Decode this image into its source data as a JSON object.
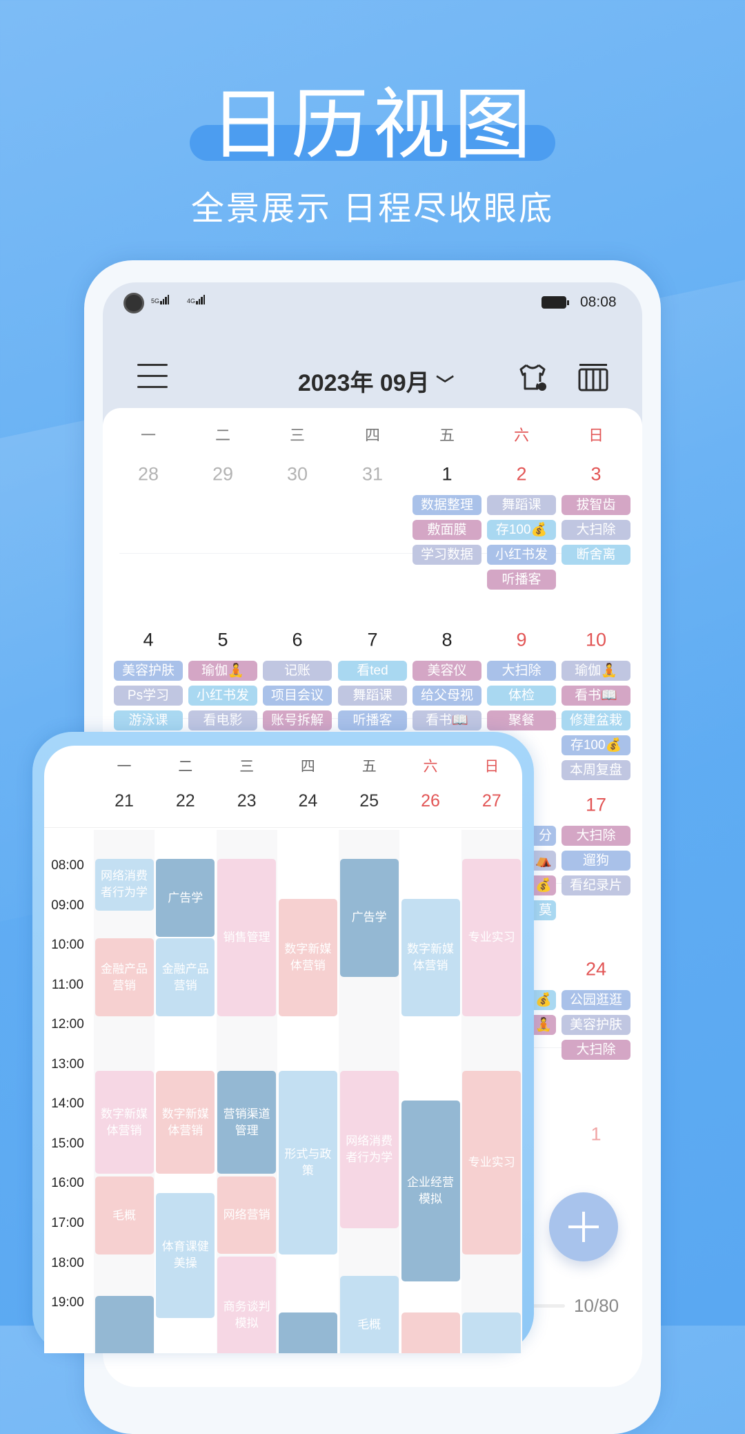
{
  "promo": {
    "title": "日历视图",
    "subtitle": "全景展示  日程尽收眼底"
  },
  "status_bar": {
    "network1": "5G",
    "network2": "4G",
    "time": "08:08"
  },
  "header": {
    "title": "2023年 09月",
    "dropdown_icon": "chevron-down-icon",
    "icons": [
      "menu-icon",
      "theme-shirt-icon",
      "view-switch-icon"
    ]
  },
  "colors": {
    "blue": "#a9c1e9",
    "lavender": "#c0c6e1",
    "mauve": "#d4a6c5",
    "cyan": "#a9d8f1",
    "weekend": "#e25555",
    "ev_light": "#c3dff2",
    "ev_dark": "#94b8d3",
    "ev_pink": "#f6d7e4",
    "ev_salmon": "#f6d0d0"
  },
  "month": {
    "weekdays": [
      "一",
      "二",
      "三",
      "四",
      "五",
      "六",
      "日"
    ],
    "weeks": [
      {
        "days": [
          {
            "weekday": 1,
            "date": "28",
            "other": true,
            "events": []
          },
          {
            "weekday": 2,
            "date": "29",
            "other": true,
            "events": []
          },
          {
            "weekday": 3,
            "date": "30",
            "other": true,
            "events": []
          },
          {
            "weekday": 4,
            "date": "31",
            "other": true,
            "events": []
          },
          {
            "weekday": 5,
            "date": "1",
            "events": [
              {
                "label": "数据整理",
                "color": "blue"
              },
              {
                "label": "敷面膜",
                "color": "mauve"
              },
              {
                "label": "学习数据",
                "color": "lavender"
              }
            ]
          },
          {
            "weekday": 6,
            "date": "2",
            "events": [
              {
                "label": "舞蹈课",
                "color": "lavender"
              },
              {
                "label": "存100💰",
                "color": "cyan"
              },
              {
                "label": "小红书发",
                "color": "blue"
              },
              {
                "label": "听播客",
                "color": "mauve"
              }
            ]
          },
          {
            "weekday": 7,
            "date": "3",
            "events": [
              {
                "label": "拔智齿",
                "color": "mauve"
              },
              {
                "label": "大扫除",
                "color": "lavender"
              },
              {
                "label": "断舍离",
                "color": "cyan"
              }
            ]
          }
        ]
      },
      {
        "days": [
          {
            "weekday": 1,
            "date": "4",
            "events": [
              {
                "label": "美容护肤",
                "color": "blue"
              },
              {
                "label": "Ps学习",
                "color": "lavender"
              },
              {
                "label": "游泳课",
                "color": "cyan"
              }
            ]
          },
          {
            "weekday": 2,
            "date": "5",
            "events": [
              {
                "label": "瑜伽🧘",
                "color": "mauve"
              },
              {
                "label": "小红书发",
                "color": "cyan"
              },
              {
                "label": "看电影",
                "color": "lavender"
              }
            ]
          },
          {
            "weekday": 3,
            "date": "6",
            "events": [
              {
                "label": "记账",
                "color": "lavender"
              },
              {
                "label": "项目会议",
                "color": "blue"
              },
              {
                "label": "账号拆解",
                "color": "mauve"
              }
            ]
          },
          {
            "weekday": 4,
            "date": "7",
            "events": [
              {
                "label": "看ted",
                "color": "cyan"
              },
              {
                "label": "舞蹈课",
                "color": "lavender"
              },
              {
                "label": "听播客",
                "color": "blue"
              }
            ]
          },
          {
            "weekday": 5,
            "date": "8",
            "events": [
              {
                "label": "美容仪",
                "color": "mauve"
              },
              {
                "label": "给父母视",
                "color": "blue"
              },
              {
                "label": "看书📖",
                "color": "lavender"
              }
            ]
          },
          {
            "weekday": 6,
            "date": "9",
            "events": [
              {
                "label": "大扫除",
                "color": "blue"
              },
              {
                "label": "体检",
                "color": "cyan"
              },
              {
                "label": "聚餐",
                "color": "mauve"
              }
            ]
          },
          {
            "weekday": 7,
            "date": "10",
            "events": [
              {
                "label": "瑜伽🧘",
                "color": "lavender"
              },
              {
                "label": "看书📖",
                "color": "mauve"
              },
              {
                "label": "修建盆栽",
                "color": "cyan"
              },
              {
                "label": "存100💰",
                "color": "blue"
              },
              {
                "label": "本周复盘",
                "color": "lavender"
              }
            ]
          }
        ]
      },
      {
        "days": [
          {
            "weekday": 6,
            "date": "",
            "fragment": true,
            "events": [
              {
                "label": "分",
                "color": "blue"
              },
              {
                "label": "⛺",
                "color": "lavender"
              },
              {
                "label": "💰",
                "color": "mauve"
              },
              {
                "label": "莫",
                "color": "cyan"
              }
            ]
          },
          {
            "weekday": 7,
            "date": "17",
            "events": [
              {
                "label": "大扫除",
                "color": "mauve"
              },
              {
                "label": "遛狗",
                "color": "blue"
              },
              {
                "label": "看纪录片",
                "color": "lavender"
              }
            ]
          }
        ]
      },
      {
        "days": [
          {
            "weekday": 6,
            "date": "",
            "fragment": true,
            "events": [
              {
                "label": "💰",
                "color": "cyan"
              },
              {
                "label": "🧘",
                "color": "mauve"
              }
            ]
          },
          {
            "weekday": 7,
            "date": "24",
            "events": [
              {
                "label": "公园逛逛",
                "color": "blue"
              },
              {
                "label": "美容护肤",
                "color": "lavender"
              },
              {
                "label": "大扫除",
                "color": "mauve"
              }
            ]
          }
        ]
      },
      {
        "days": [
          {
            "weekday": 7,
            "date": "1",
            "other": true,
            "faint": true,
            "events": []
          }
        ]
      }
    ]
  },
  "footer": {
    "counter": "10/80",
    "progress": 0.125,
    "add_button_icon": "plus-icon"
  },
  "week": {
    "weekdays": [
      "一",
      "二",
      "三",
      "四",
      "五",
      "六",
      "日"
    ],
    "dates": [
      "21",
      "22",
      "23",
      "24",
      "25",
      "26",
      "27"
    ],
    "hours": [
      "08:00",
      "09:00",
      "10:00",
      "11:00",
      "12:00",
      "13:00",
      "14:00",
      "15:00",
      "16:00",
      "17:00",
      "18:00",
      "19:00"
    ],
    "events": [
      {
        "day": 1,
        "start": "08:00",
        "end": "09:20",
        "title": "网络消费者行为学",
        "color": "ev_light"
      },
      {
        "day": 1,
        "start": "10:00",
        "end": "12:00",
        "title": "金融产品营销",
        "color": "ev_salmon"
      },
      {
        "day": 1,
        "start": "13:20",
        "end": "15:58",
        "title": "数字新媒体营销",
        "color": "ev_pink"
      },
      {
        "day": 1,
        "start": "16:00",
        "end": "18:00",
        "title": "毛概",
        "color": "ev_salmon"
      },
      {
        "day": 1,
        "start": "19:00",
        "end": "21:00",
        "title": "",
        "color": "ev_dark"
      },
      {
        "day": 2,
        "start": "08:00",
        "end": "10:00",
        "title": "广告学",
        "color": "ev_dark"
      },
      {
        "day": 2,
        "start": "10:00",
        "end": "12:00",
        "title": "金融产品营销",
        "color": "ev_light"
      },
      {
        "day": 2,
        "start": "13:20",
        "end": "15:58",
        "title": "数字新媒体营销",
        "color": "ev_salmon"
      },
      {
        "day": 2,
        "start": "16:25",
        "end": "19:35",
        "title": "体育课健美操",
        "color": "ev_light"
      },
      {
        "day": 3,
        "start": "08:00",
        "end": "12:00",
        "title": "销售管理",
        "color": "ev_pink"
      },
      {
        "day": 3,
        "start": "13:20",
        "end": "15:58",
        "title": "营销渠道管理",
        "color": "ev_dark"
      },
      {
        "day": 3,
        "start": "16:00",
        "end": "17:58",
        "title": "网络营销",
        "color": "ev_salmon"
      },
      {
        "day": 3,
        "start": "18:00",
        "end": "21:00",
        "title": "商务谈判模拟",
        "color": "ev_pink"
      },
      {
        "day": 4,
        "start": "09:00",
        "end": "12:00",
        "title": "数字新媒体营销",
        "color": "ev_salmon"
      },
      {
        "day": 4,
        "start": "13:20",
        "end": "18:00",
        "title": "形式与政策",
        "color": "ev_light"
      },
      {
        "day": 4,
        "start": "19:25",
        "end": "21:00",
        "title": "",
        "color": "ev_dark"
      },
      {
        "day": 5,
        "start": "08:00",
        "end": "11:00",
        "title": "广告学",
        "color": "ev_dark"
      },
      {
        "day": 5,
        "start": "13:20",
        "end": "17:20",
        "title": "网络消费者行为学",
        "color": "ev_pink"
      },
      {
        "day": 5,
        "start": "18:30",
        "end": "21:00",
        "title": "毛概",
        "color": "ev_light"
      },
      {
        "day": 6,
        "start": "09:00",
        "end": "12:00",
        "title": "数字新媒体营销",
        "color": "ev_light"
      },
      {
        "day": 6,
        "start": "14:05",
        "end": "18:40",
        "title": "企业经营模拟",
        "color": "ev_dark"
      },
      {
        "day": 6,
        "start": "19:25",
        "end": "21:00",
        "title": "",
        "color": "ev_salmon"
      },
      {
        "day": 7,
        "start": "08:00",
        "end": "12:00",
        "title": "专业实习",
        "color": "ev_pink"
      },
      {
        "day": 7,
        "start": "13:20",
        "end": "18:00",
        "title": "专业实习",
        "color": "ev_salmon"
      },
      {
        "day": 7,
        "start": "19:25",
        "end": "21:00",
        "title": "",
        "color": "ev_light"
      }
    ]
  }
}
